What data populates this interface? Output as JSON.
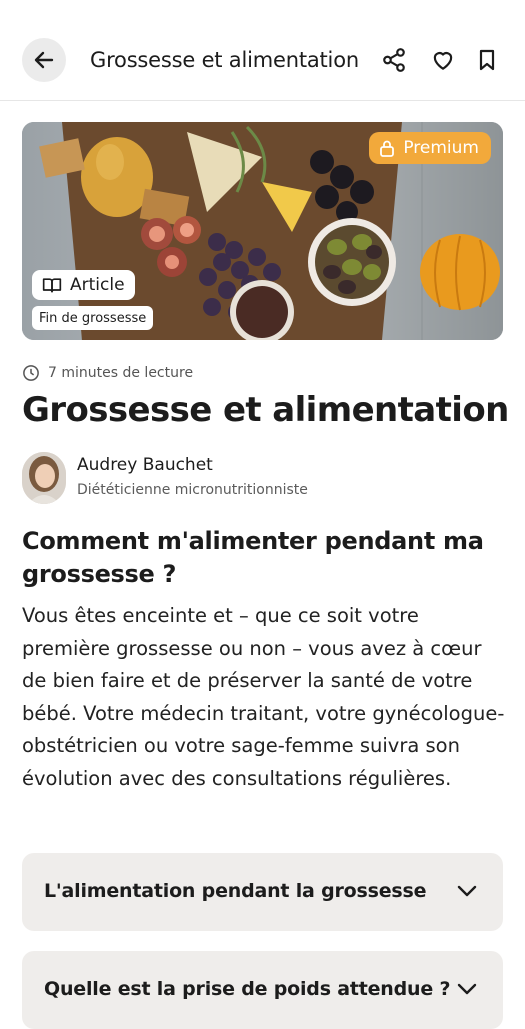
{
  "header": {
    "title": "Grossesse et alimentation",
    "back_icon": "arrow-left-icon",
    "share_icon": "share-icon",
    "favorite_icon": "heart-icon",
    "bookmark_icon": "bookmark-icon"
  },
  "hero": {
    "premium_label": "Premium",
    "article_label": "Article",
    "tag_label": "Fin de grossesse",
    "premium_color": "#f2a93b"
  },
  "article": {
    "read_time": "7 minutes de lecture",
    "title": "Grossesse et alimentation",
    "author_name": "Audrey Bauchet",
    "author_role": "Diététicienne micronutritionniste",
    "section_heading": "Comment m'alimenter pendant ma grossesse ?",
    "intro": "Vous êtes enceinte et – que ce soit votre première grossesse ou non – vous avez à cœur de bien faire et de préserver la santé de votre bébé. Votre médecin traitant, votre gynécologue-obstétricien ou votre sage-femme suivra son évolution avec des consultations régulières."
  },
  "accordions": [
    {
      "label": "L'alimentation pendant la grossesse"
    },
    {
      "label": "Quelle est la prise de poids attendue ?"
    }
  ]
}
